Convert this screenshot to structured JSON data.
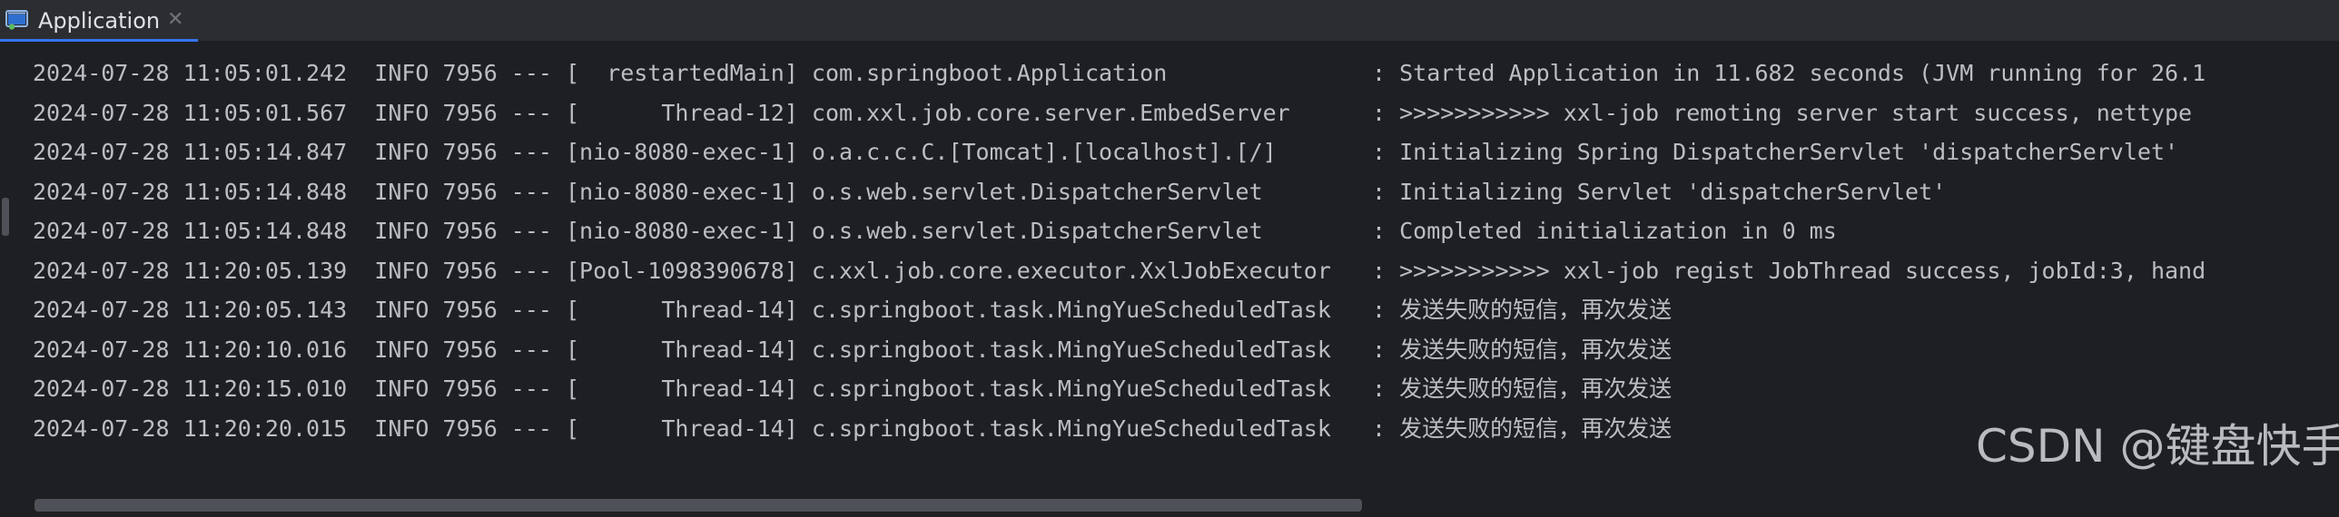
{
  "tab": {
    "title": "Application",
    "close_glyph": "✕",
    "icon": "run-console-icon"
  },
  "log_lines": [
    "2024-07-28 11:05:01.242  INFO 7956 --- [  restartedMain] com.springboot.Application               : Started Application in 11.682 seconds (JVM running for 26.1",
    "2024-07-28 11:05:01.567  INFO 7956 --- [      Thread-12] com.xxl.job.core.server.EmbedServer      : >>>>>>>>>>> xxl-job remoting server start success, nettype",
    "2024-07-28 11:05:14.847  INFO 7956 --- [nio-8080-exec-1] o.a.c.c.C.[Tomcat].[localhost].[/]       : Initializing Spring DispatcherServlet 'dispatcherServlet'",
    "2024-07-28 11:05:14.848  INFO 7956 --- [nio-8080-exec-1] o.s.web.servlet.DispatcherServlet        : Initializing Servlet 'dispatcherServlet'",
    "2024-07-28 11:05:14.848  INFO 7956 --- [nio-8080-exec-1] o.s.web.servlet.DispatcherServlet        : Completed initialization in 0 ms",
    "2024-07-28 11:20:05.139  INFO 7956 --- [Pool-1098390678] c.xxl.job.core.executor.XxlJobExecutor   : >>>>>>>>>>> xxl-job regist JobThread success, jobId:3, hand",
    "2024-07-28 11:20:05.143  INFO 7956 --- [      Thread-14] c.springboot.task.MingYueScheduledTask   : 发送失败的短信，再次发送",
    "2024-07-28 11:20:10.016  INFO 7956 --- [      Thread-14] c.springboot.task.MingYueScheduledTask   : 发送失败的短信，再次发送",
    "2024-07-28 11:20:15.010  INFO 7956 --- [      Thread-14] c.springboot.task.MingYueScheduledTask   : 发送失败的短信，再次发送",
    "2024-07-28 11:20:20.015  INFO 7956 --- [      Thread-14] c.springboot.task.MingYueScheduledTask   : 发送失败的短信，再次发送"
  ],
  "watermark": "CSDN @键盘快手",
  "colors": {
    "background": "#1e1f22",
    "text": "#bcbec4",
    "accent": "#3574f0"
  }
}
